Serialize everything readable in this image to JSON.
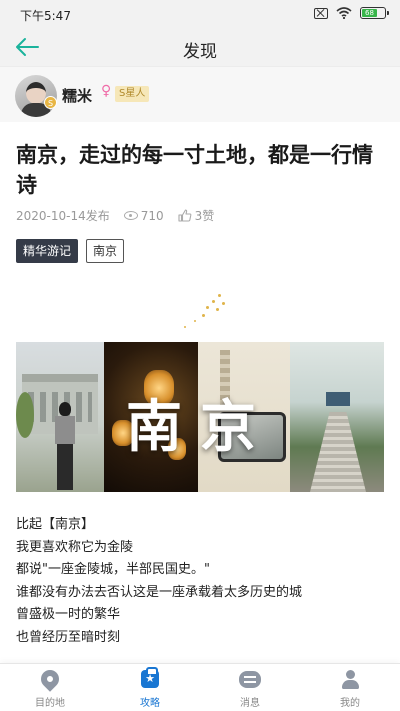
{
  "status_bar": {
    "time": "下午5:47",
    "battery": "68"
  },
  "nav": {
    "title": "发现",
    "back_icon": "arrow-left-icon",
    "accent_color": "#1bb39c"
  },
  "author": {
    "name": "糯米",
    "gender_symbol": "♀",
    "avatar_badge": "S",
    "level_badge": "S星人"
  },
  "article": {
    "title": "南京，走过的每一寸土地，都是一行情诗",
    "date": "2020-10-14发布",
    "views": "710",
    "likes": "3赞",
    "tags": [
      "精华游记",
      "南京"
    ],
    "banner_text": "南京",
    "paragraphs": [
      "比起【南京】",
      "我更喜欢称它为金陵",
      "都说\"一座金陵城，半部民国史。\"",
      "谁都没有办法去否认这是一座承载着太多历史的城",
      "曾盛极一时的繁华",
      "也曾经历至暗时刻"
    ]
  },
  "tab_bar": {
    "active_color": "#1976d2",
    "items": [
      {
        "label": "目的地",
        "icon": "location-pin-icon"
      },
      {
        "label": "攻略",
        "icon": "guide-book-icon",
        "active": true
      },
      {
        "label": "消息",
        "icon": "message-icon"
      },
      {
        "label": "我的",
        "icon": "profile-icon"
      }
    ]
  }
}
